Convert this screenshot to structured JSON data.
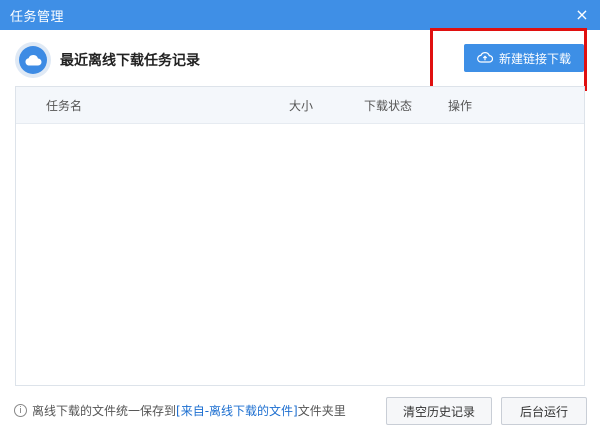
{
  "window": {
    "title": "任务管理",
    "close_glyph": "×"
  },
  "header": {
    "icon": "cloud-icon",
    "heading": "最近离线下载任务记录",
    "new_link_button": {
      "label": "新建链接下载",
      "icon": "cloud-upload-icon"
    }
  },
  "table": {
    "columns": [
      "任务名",
      "大小",
      "下载状态",
      "操作"
    ],
    "rows": []
  },
  "footer": {
    "info_icon": "info-icon",
    "info_prefix": "离线下载的文件统一保存到",
    "info_link": "[来自-离线下载的文件]",
    "info_suffix": "文件夹里",
    "clear_history_label": "清空历史记录",
    "background_run_label": "后台运行"
  },
  "colors": {
    "titlebar": "#3f8fe6",
    "primary_button": "#3d8fe6",
    "highlight": "#e01010",
    "link": "#1d6fd0"
  }
}
